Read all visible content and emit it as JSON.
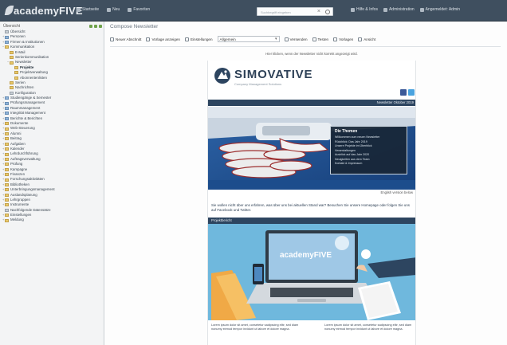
{
  "app": {
    "logo": "academyFIVE",
    "nav": [
      {
        "label": "Startseite",
        "icon": "home-icon"
      },
      {
        "label": "Neu",
        "icon": "plus-icon"
      },
      {
        "label": "Favoriten",
        "icon": "star-icon"
      }
    ],
    "search_placeholder": "Suchbegriff eingeben",
    "right_nav": [
      {
        "label": "Hilfe & Infos",
        "icon": "help-icon"
      },
      {
        "label": "Administration",
        "icon": "gear-icon"
      },
      {
        "label": "Angemeldet: Admin",
        "icon": "user-icon"
      }
    ]
  },
  "sidebar": {
    "title": "Übersicht",
    "items": [
      {
        "label": "Übersicht",
        "indent": 0,
        "toggle": "",
        "icon": "grey"
      },
      {
        "label": "Personen",
        "indent": 0,
        "toggle": "+",
        "icon": "blue"
      },
      {
        "label": "Firmen & Institutionen",
        "indent": 0,
        "toggle": "+",
        "icon": "blue"
      },
      {
        "label": "Kommunikation",
        "indent": 0,
        "toggle": "−",
        "icon": "yellow"
      },
      {
        "label": "E-Mail",
        "indent": 1,
        "toggle": "",
        "icon": "yellow"
      },
      {
        "label": "Serienkommunikation",
        "indent": 1,
        "toggle": "",
        "icon": "yellow"
      },
      {
        "label": "Newsletter",
        "indent": 1,
        "toggle": "−",
        "icon": "yellow"
      },
      {
        "label": "Projekte",
        "indent": 2,
        "toggle": "",
        "icon": "yellow",
        "selected": true
      },
      {
        "label": "Projektverwaltung",
        "indent": 2,
        "toggle": "",
        "icon": "yellow"
      },
      {
        "label": "Abonnentenlisten",
        "indent": 2,
        "toggle": "",
        "icon": "yellow"
      },
      {
        "label": "Serien",
        "indent": 1,
        "toggle": "",
        "icon": "yellow"
      },
      {
        "label": "Nachrichten",
        "indent": 1,
        "toggle": "",
        "icon": "yellow"
      },
      {
        "label": "Konfiguration",
        "indent": 1,
        "toggle": "",
        "icon": "grey"
      },
      {
        "label": "Studiengänge & Semester",
        "indent": 0,
        "toggle": "+",
        "icon": "blue"
      },
      {
        "label": "Prüfungsmanagement",
        "indent": 0,
        "toggle": "+",
        "icon": "blue"
      },
      {
        "label": "Raummanagement",
        "indent": 0,
        "toggle": "+",
        "icon": "blue"
      },
      {
        "label": "Integrität Management",
        "indent": 0,
        "toggle": "+",
        "icon": "blue"
      },
      {
        "label": "Berichte & Berichten",
        "indent": 0,
        "toggle": "+",
        "icon": "blue"
      },
      {
        "label": "Dokumente",
        "indent": 0,
        "toggle": "+",
        "icon": "yellow"
      },
      {
        "label": "Web-Steuerung",
        "indent": 0,
        "toggle": "+",
        "icon": "yellow"
      },
      {
        "label": "Alumni",
        "indent": 0,
        "toggle": "+",
        "icon": "yellow"
      },
      {
        "label": "Beitrag",
        "indent": 0,
        "toggle": "+",
        "icon": "yellow"
      },
      {
        "label": "Aufgaben",
        "indent": 0,
        "toggle": "+",
        "icon": "yellow"
      },
      {
        "label": "Kalender",
        "indent": 0,
        "toggle": "+",
        "icon": "yellow"
      },
      {
        "label": "Lehrdurchführung",
        "indent": 0,
        "toggle": "+",
        "icon": "yellow"
      },
      {
        "label": "Auftragsverwaltung",
        "indent": 0,
        "toggle": "+",
        "icon": "yellow"
      },
      {
        "label": "Prüfung",
        "indent": 0,
        "toggle": "+",
        "icon": "yellow"
      },
      {
        "label": "Kampagne",
        "indent": 0,
        "toggle": "+",
        "icon": "yellow"
      },
      {
        "label": "Finanzen",
        "indent": 0,
        "toggle": "+",
        "icon": "yellow"
      },
      {
        "label": "Forschungsaktivitäten",
        "indent": 0,
        "toggle": "+",
        "icon": "yellow"
      },
      {
        "label": "Bibliotheken",
        "indent": 0,
        "toggle": "+",
        "icon": "yellow"
      },
      {
        "label": "Unterbringungsmanagement",
        "indent": 0,
        "toggle": "+",
        "icon": "yellow"
      },
      {
        "label": "Auslandsplanung",
        "indent": 0,
        "toggle": "+",
        "icon": "yellow"
      },
      {
        "label": "Lehrgruppen",
        "indent": 0,
        "toggle": "+",
        "icon": "yellow"
      },
      {
        "label": "Instrumente",
        "indent": 0,
        "toggle": "+",
        "icon": "yellow"
      },
      {
        "label": "Nachfolgende Datensätze",
        "indent": 0,
        "toggle": "",
        "icon": "grey"
      },
      {
        "label": "Einstellungen",
        "indent": 0,
        "toggle": "+",
        "icon": "yellow"
      },
      {
        "label": "Meldung",
        "indent": 0,
        "toggle": "+",
        "icon": "yellow"
      }
    ]
  },
  "main": {
    "title": "Compose Newsletter",
    "toolbar": [
      {
        "label": "Neuer Abschnitt",
        "icon": "add-section-icon"
      },
      {
        "label": "Vorlage anzeigen",
        "icon": "preview-icon"
      },
      {
        "label": "Einstellungen",
        "icon": "settings-icon"
      }
    ],
    "selector_label": "Allgemein",
    "actions": [
      {
        "label": "Versenden",
        "icon": "send-icon"
      },
      {
        "label": "Testen",
        "icon": "test-icon"
      },
      {
        "label": "Vorlagen",
        "icon": "template-icon"
      },
      {
        "label": "Ansicht",
        "icon": "view-icon"
      }
    ],
    "browser_link": "Hier klicken, wenn der Newsletter nicht korrekt angezeigt wird."
  },
  "newsletter": {
    "brand": "SIMOVATIVE",
    "brand_sub": "Company Management Solutions",
    "issue": "Newsletter Oktober 2019",
    "themes_title": "Die Themen",
    "themes": [
      "Willkommen zum neuen Newsletter",
      "Rückblick: Das Jahr 2019",
      "Unsere Projekte im Überblick",
      "Veranstaltungen",
      "Ausblick auf das Jahr 2020",
      "Neuigkeiten aus dem Team",
      "Kontakt & Impressum"
    ],
    "image_credit": "English version below",
    "intro": "Sie wollen nicht über uns erfahren, was über uns bei aktuellen Stand war? Besuchen Sie unsere Homepage oder folgen Sie uns auf Facebook und Twitter.",
    "section_title": "Projektbericht",
    "col1": "Lorem ipsum dolor sit amet, consetetur sadipscing elitr, sed diam nonumy eirmod tempor invidunt ut labore et dolore magna.",
    "col2": "Lorem ipsum dolor sit amet, consetetur sadipscing elitr, sed diam nonumy eirmod tempor invidunt ut labore et dolore magna."
  },
  "colors": {
    "topbar": "#3f4f5f",
    "brand_navy": "#2d4560",
    "sky": "#6fb8dd",
    "folder": "#e8c86a"
  }
}
